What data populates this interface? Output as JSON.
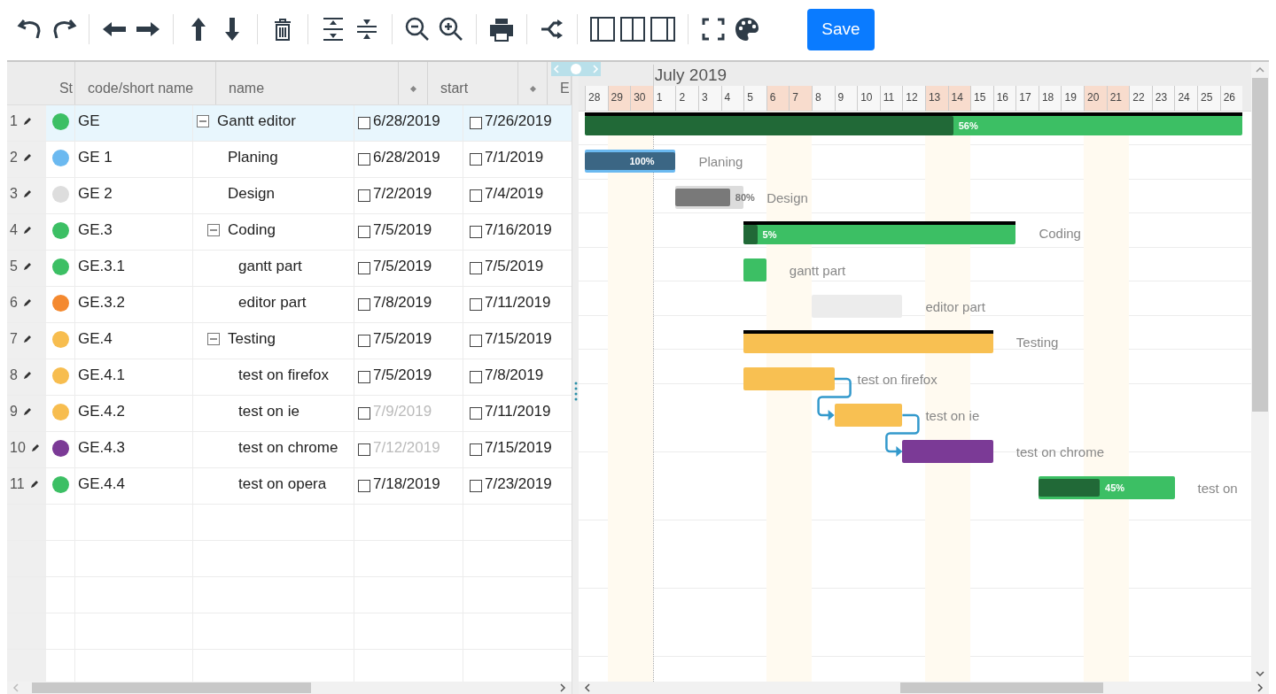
{
  "toolbar": {
    "save_label": "Save"
  },
  "grid": {
    "columns": [
      {
        "label": "St",
        "sortable": false
      },
      {
        "label": "code/short name",
        "sortable": false
      },
      {
        "label": "name",
        "sortable": true
      },
      {
        "label": "start",
        "sortable": true
      },
      {
        "label": "E",
        "sortable": false
      }
    ]
  },
  "timeline": {
    "month": "July 2019",
    "days": [
      {
        "label": "28",
        "weekend": false
      },
      {
        "label": "29",
        "weekend": true
      },
      {
        "label": "30",
        "weekend": true
      },
      {
        "label": "1",
        "weekend": false
      },
      {
        "label": "2",
        "weekend": false
      },
      {
        "label": "3",
        "weekend": false
      },
      {
        "label": "4",
        "weekend": false
      },
      {
        "label": "5",
        "weekend": false
      },
      {
        "label": "6",
        "weekend": true
      },
      {
        "label": "7",
        "weekend": true
      },
      {
        "label": "8",
        "weekend": false
      },
      {
        "label": "9",
        "weekend": false
      },
      {
        "label": "10",
        "weekend": false
      },
      {
        "label": "11",
        "weekend": false
      },
      {
        "label": "12",
        "weekend": false
      },
      {
        "label": "13",
        "weekend": true
      },
      {
        "label": "14",
        "weekend": true
      },
      {
        "label": "15",
        "weekend": false
      },
      {
        "label": "16",
        "weekend": false
      },
      {
        "label": "17",
        "weekend": false
      },
      {
        "label": "18",
        "weekend": false
      },
      {
        "label": "19",
        "weekend": false
      },
      {
        "label": "20",
        "weekend": true
      },
      {
        "label": "21",
        "weekend": true
      },
      {
        "label": "22",
        "weekend": false
      },
      {
        "label": "23",
        "weekend": false
      },
      {
        "label": "24",
        "weekend": false
      },
      {
        "label": "25",
        "weekend": false
      },
      {
        "label": "26",
        "weekend": false
      }
    ]
  },
  "tasks": [
    {
      "row": "1",
      "color": "#3cbf64",
      "code": "GE",
      "name": "Gantt editor",
      "expanded": true,
      "selected": true,
      "start": "6/28/2019",
      "start_checked": false,
      "start_dimmed": false,
      "end": "7/26/2019",
      "end_checked": false,
      "linked": false,
      "bar": {
        "color": "#3cbf64",
        "level": 0.56,
        "progress_label": "56%"
      },
      "children": [
        {
          "row": "2",
          "color": "#6bb9f0",
          "code": "GE 1",
          "name": "Planing",
          "selected": false,
          "start": "6/28/2019",
          "start_checked": false,
          "start_dimmed": false,
          "end": "7/1/2019",
          "end_checked": false,
          "linked": false,
          "bar": {
            "color": "#6bb9f0",
            "level": 1,
            "progress_label": "100%",
            "label": "Planing"
          }
        },
        {
          "row": "3",
          "color": "#dddddd",
          "code": "GE 2",
          "name": "Design",
          "selected": false,
          "start": "7/2/2019",
          "start_checked": false,
          "start_dimmed": false,
          "end": "7/4/2019",
          "end_checked": false,
          "linked": false,
          "bar": {
            "color": "#dcdcdc",
            "level": 0.8,
            "progress_label": "80%",
            "label": "Design"
          }
        },
        {
          "row": "4",
          "color": "#3cbf64",
          "code": "GE.3",
          "name": "Coding",
          "expanded": true,
          "selected": false,
          "start": "7/5/2019",
          "start_checked": false,
          "start_dimmed": false,
          "end": "7/16/2019",
          "end_checked": false,
          "linked": false,
          "bar": {
            "color": "#3cbf64",
            "level": 0.05,
            "progress_label": "5%",
            "label": "Coding"
          },
          "children": [
            {
              "row": "5",
              "color": "#3cbf64",
              "code": "GE.3.1",
              "name": "gantt part",
              "selected": false,
              "start": "7/5/2019",
              "start_checked": false,
              "start_dimmed": false,
              "end": "7/5/2019",
              "end_checked": false,
              "linked": false,
              "bar": {
                "color": "#3cbf64",
                "label": "gantt part"
              }
            },
            {
              "row": "6",
              "color": "#f4892f",
              "code": "GE.3.2",
              "name": "editor part",
              "selected": false,
              "start": "7/8/2019",
              "start_checked": false,
              "start_dimmed": false,
              "end": "7/11/2019",
              "end_checked": false,
              "linked": false,
              "bar": {
                "color": "#ececec",
                "label": "editor part"
              }
            }
          ]
        },
        {
          "row": "7",
          "color": "#f7bd4f",
          "code": "GE.4",
          "name": "Testing",
          "expanded": true,
          "selected": false,
          "start": "7/5/2019",
          "start_checked": false,
          "start_dimmed": false,
          "end": "7/15/2019",
          "end_checked": false,
          "linked": false,
          "bar": {
            "color": "#f8c052",
            "label": "Testing"
          },
          "children": [
            {
              "row": "8",
              "color": "#f7bd4f",
              "code": "GE.4.1",
              "name": "test on firefox",
              "selected": false,
              "start": "7/5/2019",
              "start_checked": false,
              "start_dimmed": false,
              "end": "7/8/2019",
              "end_checked": false,
              "linked": false,
              "bar": {
                "color": "#f8c052",
                "label": "test on firefox"
              }
            },
            {
              "row": "9",
              "color": "#f7bd4f",
              "code": "GE.4.2",
              "name": "test on ie",
              "selected": false,
              "start": "7/9/2019",
              "start_checked": false,
              "start_dimmed": true,
              "end": "7/11/2019",
              "end_checked": false,
              "linked": true,
              "bar": {
                "color": "#f8c052",
                "label": "test on ie"
              }
            },
            {
              "row": "10",
              "color": "#7b3a96",
              "code": "GE.4.3",
              "name": "test on chrome",
              "selected": false,
              "start": "7/12/2019",
              "start_checked": false,
              "start_dimmed": true,
              "end": "7/15/2019",
              "end_checked": false,
              "linked": true,
              "bar": {
                "color": "#7b3a96",
                "label": "test on chrome"
              }
            },
            {
              "row": "11",
              "color": "#3cbf64",
              "code": "GE.4.4",
              "name": "test on opera",
              "selected": false,
              "start": "7/18/2019",
              "start_checked": false,
              "start_dimmed": false,
              "end": "7/23/2019",
              "end_checked": false,
              "linked": false,
              "bar": {
                "color": "#3cbf64",
                "level": 0.45,
                "progress_label": "45%",
                "label": "test on"
              }
            }
          ]
        }
      ]
    }
  ]
}
